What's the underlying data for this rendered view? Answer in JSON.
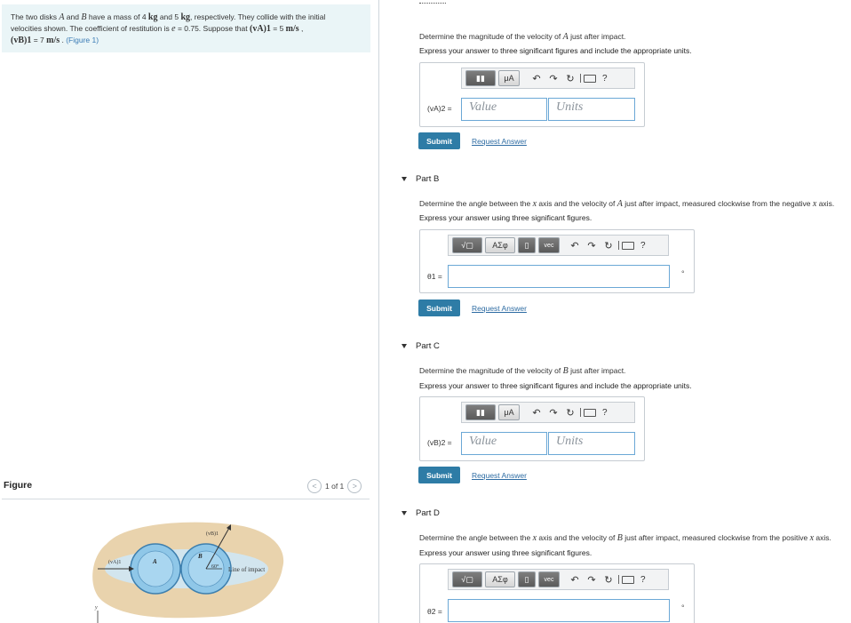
{
  "problem": {
    "t1": "The two disks ",
    "A": "A",
    "t2": " and ",
    "B": "B",
    "t3": " have a mass of 4 ",
    "kg": "kg",
    "t4": " and 5 ",
    "kg2": "kg",
    "t5": ", respectively. They collide with the initial",
    "line2": "velocities shown. The coefficient of restitution is ",
    "e": "e",
    "line2b": " = 0.75. Suppose that ",
    "vA1": "(vA)1",
    "line2c": " = 5 ",
    "ms": "m/s",
    "line2d": " ,",
    "vB1": "(vB)1",
    "line3b": " = 7 ",
    "ms2": "m/s",
    "line3c": " . ",
    "figure_link": "(Figure 1)"
  },
  "figure": {
    "label": "Figure",
    "pager": "1 of 1",
    "prev_glyph": "<",
    "next_glyph": ">",
    "labels": {
      "vA": "(vA)1",
      "vB": "(vB)1",
      "A": "A",
      "B": "B",
      "angle": "60°",
      "line_of_impact": "Line of impact",
      "y": "y"
    }
  },
  "toolbar": {
    "mu": "μA",
    "sqrt": "√▢",
    "greek": "ΑΣφ",
    "vec": "vec",
    "help": "?"
  },
  "partA": {
    "desc1": "Determine the magnitude of the velocity of ",
    "descVar": "A",
    "desc2": " just after impact.",
    "instr": "Express your answer to three significant figures and include the appropriate units.",
    "lhs": "(vA)2 =",
    "value_placeholder": "Value",
    "units_placeholder": "Units",
    "submit": "Submit",
    "request": "Request Answer"
  },
  "partB": {
    "title": "Part B",
    "desc1": "Determine the angle between the ",
    "descX": "x",
    "desc2": " axis and the velocity of ",
    "descVar": "A",
    "desc3": " just after impact, measured clockwise from the negative ",
    "descX2": "x",
    "desc4": " axis.",
    "instr": "Express your answer using three significant figures.",
    "lhs": "θ1 =",
    "unit": "°",
    "submit": "Submit",
    "request": "Request Answer"
  },
  "partC": {
    "title": "Part C",
    "desc1": "Determine the magnitude of the velocity of ",
    "descVar": "B",
    "desc2": " just after impact.",
    "instr": "Express your answer to three significant figures and include the appropriate units.",
    "lhs": "(vB)2 =",
    "value_placeholder": "Value",
    "units_placeholder": "Units",
    "submit": "Submit",
    "request": "Request Answer"
  },
  "partD": {
    "title": "Part D",
    "desc1": "Determine the angle between the ",
    "descX": "x",
    "desc2": " axis and the velocity of ",
    "descVar": "B",
    "desc3": " just after impact, measured clockwise from the positive ",
    "descX2": "x",
    "desc4": " axis.",
    "instr": "Express your answer using three significant figures.",
    "lhs": "θ2 =",
    "unit": "°"
  },
  "colors": {
    "accent": "#2e7ca6",
    "link": "#2e6ca3",
    "problem_bg": "#eaf5f7",
    "field_border": "#6ba8d6"
  }
}
